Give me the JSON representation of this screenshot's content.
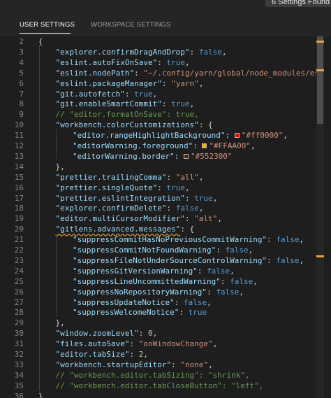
{
  "top_notice": "6 Settings Found",
  "tabs": {
    "user": "USER SETTINGS",
    "workspace": "WORKSPACE SETTINGS"
  },
  "colors": {
    "background": "#1e1e1e",
    "key": "#9cdcfe",
    "string": "#ce9178",
    "boolean": "#569cd6",
    "number": "#b5cea8",
    "comment": "#6a9955",
    "warning_squiggle": "#e5a43b"
  },
  "editor": {
    "lines": [
      {
        "num": "2",
        "indent": 0,
        "tokens": [
          {
            "c": "p",
            "t": "{"
          }
        ]
      },
      {
        "num": "3",
        "indent": 1,
        "tokens": [
          {
            "c": "k",
            "t": "\"explorer.confirmDragAndDrop\""
          },
          {
            "c": "p",
            "t": ": "
          },
          {
            "c": "b",
            "t": "false"
          },
          {
            "c": "p",
            "t": ","
          }
        ]
      },
      {
        "num": "4",
        "indent": 1,
        "tokens": [
          {
            "c": "k",
            "t": "\"eslint.autoFixOnSave\""
          },
          {
            "c": "p",
            "t": ": "
          },
          {
            "c": "b",
            "t": "true"
          },
          {
            "c": "p",
            "t": ","
          }
        ]
      },
      {
        "num": "5",
        "indent": 1,
        "tokens": [
          {
            "c": "k",
            "t": "\"eslint.nodePath\""
          },
          {
            "c": "p",
            "t": ": "
          },
          {
            "c": "s",
            "t": "\"~/.config/yarn/global/node_modules/eslint/"
          }
        ]
      },
      {
        "num": "6",
        "indent": 1,
        "tokens": [
          {
            "c": "k",
            "t": "\"eslint.packageManager\""
          },
          {
            "c": "p",
            "t": ": "
          },
          {
            "c": "s",
            "t": "\"yarn\""
          },
          {
            "c": "p",
            "t": ","
          }
        ]
      },
      {
        "num": "7",
        "indent": 1,
        "tokens": [
          {
            "c": "k",
            "t": "\"git.autofetch\""
          },
          {
            "c": "p",
            "t": ": "
          },
          {
            "c": "b",
            "t": "true"
          },
          {
            "c": "p",
            "t": ","
          }
        ]
      },
      {
        "num": "8",
        "indent": 1,
        "tokens": [
          {
            "c": "k",
            "t": "\"git.enableSmartCommit\""
          },
          {
            "c": "p",
            "t": ": "
          },
          {
            "c": "b",
            "t": "true"
          },
          {
            "c": "p",
            "t": ","
          }
        ]
      },
      {
        "num": "9",
        "indent": 1,
        "tokens": [
          {
            "c": "c",
            "t": "// \"editor.formatOnSave\": true,"
          }
        ]
      },
      {
        "num": "10",
        "indent": 1,
        "tokens": [
          {
            "c": "k",
            "t": "\"workbench.colorCustomizations\""
          },
          {
            "c": "p",
            "t": ": {"
          }
        ]
      },
      {
        "num": "11",
        "indent": 2,
        "tokens": [
          {
            "c": "k",
            "t": "\"editor.rangeHighlightBackground\""
          },
          {
            "c": "p",
            "t": ": "
          },
          {
            "sw": "#ff0000"
          },
          {
            "c": "s",
            "t": "\"#ff0000\""
          },
          {
            "c": "p",
            "t": ","
          }
        ]
      },
      {
        "num": "12",
        "indent": 2,
        "tokens": [
          {
            "c": "k",
            "t": "\"editorWarning.foreground\""
          },
          {
            "c": "p",
            "t": ": "
          },
          {
            "sw": "#FFAA00"
          },
          {
            "c": "s",
            "t": "\"#FFAA00\""
          },
          {
            "c": "p",
            "t": ","
          }
        ]
      },
      {
        "num": "13",
        "indent": 2,
        "tokens": [
          {
            "c": "k",
            "t": "\"editorWarning.border\""
          },
          {
            "c": "p",
            "t": ": "
          },
          {
            "sw": "#552300"
          },
          {
            "c": "s",
            "t": "\"#552300\""
          }
        ]
      },
      {
        "num": "14",
        "indent": 1,
        "tokens": [
          {
            "c": "p",
            "t": "},"
          }
        ]
      },
      {
        "num": "15",
        "indent": 1,
        "tokens": [
          {
            "c": "k",
            "t": "\"prettier.trailingComma\""
          },
          {
            "c": "p",
            "t": ": "
          },
          {
            "c": "s",
            "t": "\"all\""
          },
          {
            "c": "p",
            "t": ","
          }
        ]
      },
      {
        "num": "16",
        "indent": 1,
        "tokens": [
          {
            "c": "k",
            "t": "\"prettier.singleQuote\""
          },
          {
            "c": "p",
            "t": ": "
          },
          {
            "c": "b",
            "t": "true"
          },
          {
            "c": "p",
            "t": ","
          }
        ]
      },
      {
        "num": "17",
        "indent": 1,
        "tokens": [
          {
            "c": "k",
            "t": "\"prettier.eslintIntegration\""
          },
          {
            "c": "p",
            "t": ": "
          },
          {
            "c": "b",
            "t": "true"
          },
          {
            "c": "p",
            "t": ","
          }
        ]
      },
      {
        "num": "18",
        "indent": 1,
        "tokens": [
          {
            "c": "k",
            "t": "\"explorer.confirmDelete\""
          },
          {
            "c": "p",
            "t": ": "
          },
          {
            "c": "b",
            "t": "false"
          },
          {
            "c": "p",
            "t": ","
          }
        ]
      },
      {
        "num": "19",
        "indent": 1,
        "tokens": [
          {
            "c": "k",
            "t": "\"editor.multiCursorModifier\""
          },
          {
            "c": "p",
            "t": ": "
          },
          {
            "c": "s",
            "t": "\"alt\""
          },
          {
            "c": "p",
            "t": ","
          }
        ]
      },
      {
        "num": "20",
        "indent": 1,
        "tokens": [
          {
            "c": "k",
            "t": "\"gitlens.advanced.messages\"",
            "squig": true
          },
          {
            "c": "p",
            "t": ": {"
          }
        ]
      },
      {
        "num": "21",
        "indent": 2,
        "tokens": [
          {
            "c": "k",
            "t": "\"suppressCommitHasNoPreviousCommitWarning\""
          },
          {
            "c": "p",
            "t": ": "
          },
          {
            "c": "b",
            "t": "false"
          },
          {
            "c": "p",
            "t": ","
          }
        ]
      },
      {
        "num": "22",
        "indent": 2,
        "tokens": [
          {
            "c": "k",
            "t": "\"suppressCommitNotFoundWarning\""
          },
          {
            "c": "p",
            "t": ": "
          },
          {
            "c": "b",
            "t": "false"
          },
          {
            "c": "p",
            "t": ","
          }
        ]
      },
      {
        "num": "23",
        "indent": 2,
        "tokens": [
          {
            "c": "k",
            "t": "\"suppressFileNotUnderSourceControlWarning\""
          },
          {
            "c": "p",
            "t": ": "
          },
          {
            "c": "b",
            "t": "false"
          },
          {
            "c": "p",
            "t": ","
          }
        ]
      },
      {
        "num": "24",
        "indent": 2,
        "tokens": [
          {
            "c": "k",
            "t": "\"suppressGitVersionWarning\""
          },
          {
            "c": "p",
            "t": ": "
          },
          {
            "c": "b",
            "t": "false"
          },
          {
            "c": "p",
            "t": ","
          }
        ]
      },
      {
        "num": "25",
        "indent": 2,
        "tokens": [
          {
            "c": "k",
            "t": "\"suppressLineUncommittedWarning\""
          },
          {
            "c": "p",
            "t": ": "
          },
          {
            "c": "b",
            "t": "false"
          },
          {
            "c": "p",
            "t": ","
          }
        ]
      },
      {
        "num": "26",
        "indent": 2,
        "tokens": [
          {
            "c": "k",
            "t": "\"suppressNoRepositoryWarning\""
          },
          {
            "c": "p",
            "t": ": "
          },
          {
            "c": "b",
            "t": "false"
          },
          {
            "c": "p",
            "t": ","
          }
        ]
      },
      {
        "num": "27",
        "indent": 2,
        "tokens": [
          {
            "c": "k",
            "t": "\"suppressUpdateNotice\""
          },
          {
            "c": "p",
            "t": ": "
          },
          {
            "c": "b",
            "t": "false"
          },
          {
            "c": "p",
            "t": ","
          }
        ]
      },
      {
        "num": "28",
        "indent": 2,
        "tokens": [
          {
            "c": "k",
            "t": "\"suppressWelcomeNotice\""
          },
          {
            "c": "p",
            "t": ": "
          },
          {
            "c": "b",
            "t": "true"
          }
        ]
      },
      {
        "num": "29",
        "indent": 1,
        "tokens": [
          {
            "c": "p",
            "t": "},"
          }
        ]
      },
      {
        "num": "30",
        "indent": 1,
        "tokens": [
          {
            "c": "k",
            "t": "\"window.zoomLevel\""
          },
          {
            "c": "p",
            "t": ": "
          },
          {
            "c": "n",
            "t": "0"
          },
          {
            "c": "p",
            "t": ","
          }
        ]
      },
      {
        "num": "31",
        "indent": 1,
        "tokens": [
          {
            "c": "k",
            "t": "\"files.autoSave\""
          },
          {
            "c": "p",
            "t": ": "
          },
          {
            "c": "s",
            "t": "\"onWindowChange\""
          },
          {
            "c": "p",
            "t": ","
          }
        ]
      },
      {
        "num": "32",
        "indent": 1,
        "tokens": [
          {
            "c": "k",
            "t": "\"editor.tabSize\""
          },
          {
            "c": "p",
            "t": ": "
          },
          {
            "c": "n",
            "t": "2"
          },
          {
            "c": "p",
            "t": ","
          }
        ]
      },
      {
        "num": "33",
        "indent": 1,
        "tokens": [
          {
            "c": "k",
            "t": "\"workbench.startupEditor\""
          },
          {
            "c": "p",
            "t": ": "
          },
          {
            "c": "s",
            "t": "\"none\""
          },
          {
            "c": "p",
            "t": ","
          }
        ]
      },
      {
        "num": "34",
        "indent": 1,
        "tokens": [
          {
            "c": "c",
            "t": "// \"workbench.editor.tabSizing\": \"shrink\","
          }
        ]
      },
      {
        "num": "35",
        "indent": 1,
        "tokens": [
          {
            "c": "c",
            "t": "// \"workbench.editor.tabCloseButton\": \"left\","
          }
        ]
      },
      {
        "num": "36",
        "indent": 0,
        "tokens": [
          {
            "c": "p",
            "t": "}"
          }
        ]
      }
    ]
  }
}
